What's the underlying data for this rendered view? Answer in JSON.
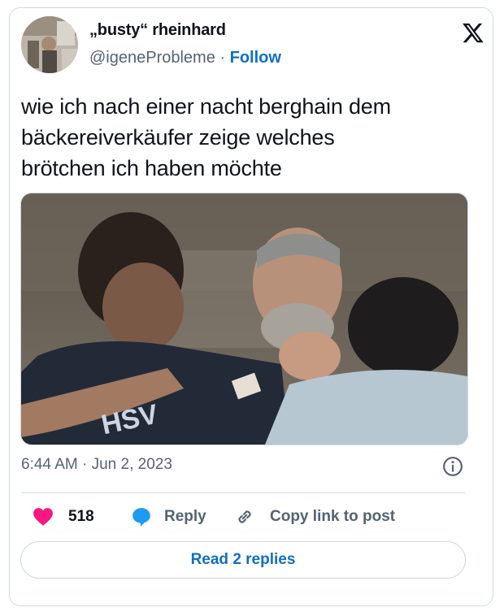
{
  "author": {
    "display_name": "„busty“ rheinhard",
    "handle": "@igeneProbleme",
    "separator": " · ",
    "follow_label": "Follow"
  },
  "tweet": {
    "text_lines": [
      "wie ich nach einer nacht berghain dem",
      "bäckereiverkäufer zeige welches",
      "brötchen ich haben möchte"
    ],
    "timestamp": "6:44 AM · Jun 2, 2023",
    "media_overlay_text": "HSV"
  },
  "actions": {
    "like_count": "518",
    "reply_label": "Reply",
    "copy_link_label": "Copy link to post"
  },
  "read_replies_label": "Read 2 replies",
  "icons": {
    "brand": "x-logo-icon",
    "like": "heart-icon",
    "reply": "speech-bubble-icon",
    "copy": "link-icon",
    "info": "info-icon"
  },
  "colors": {
    "like": "#f91880",
    "reply": "#1d9bf0",
    "follow": "#0f6fc6",
    "muted": "#536471",
    "border": "#cfd9de"
  }
}
